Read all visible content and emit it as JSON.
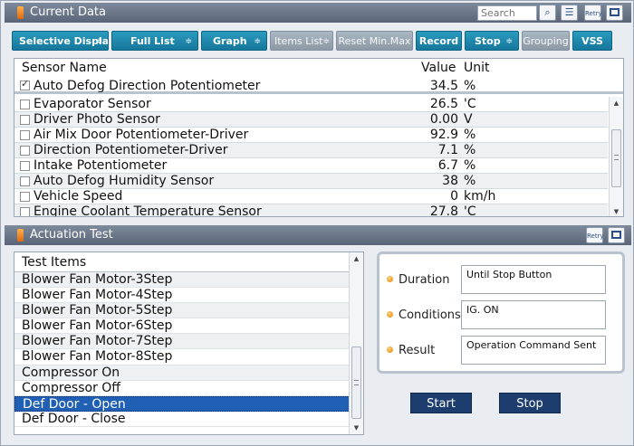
{
  "current_data": {
    "title": "Current Data",
    "search_placeholder": "Search",
    "retry_label": "Retry",
    "toolbar": {
      "selective_display": "Selective Display",
      "full_list": "Full List",
      "graph": "Graph",
      "items_list": "Items List",
      "reset_min_max": "Reset Min.Max",
      "record": "Record",
      "stop": "Stop",
      "grouping": "Grouping",
      "vss": "VSS",
      "dropdown_glyph": "≑"
    },
    "columns": {
      "name": "Sensor Name",
      "value": "Value",
      "unit": "Unit"
    },
    "pinned_row": {
      "name": "Auto Defog Direction Potentiometer",
      "value": "34.5",
      "unit": "%",
      "checked": true
    },
    "rows": [
      {
        "name": "Evaporator Sensor",
        "value": "26.5",
        "unit": "'C"
      },
      {
        "name": "Driver Photo Sensor",
        "value": "0.00",
        "unit": "V"
      },
      {
        "name": "Air Mix Door Potentiometer-Driver",
        "value": "92.9",
        "unit": "%"
      },
      {
        "name": "Direction Potentiometer-Driver",
        "value": "7.1",
        "unit": "%"
      },
      {
        "name": "Intake Potentiometer",
        "value": "6.7",
        "unit": "%"
      },
      {
        "name": "Auto Defog Humidity Sensor",
        "value": "38",
        "unit": "%"
      },
      {
        "name": "Vehicle Speed",
        "value": "0",
        "unit": "km/h"
      },
      {
        "name": "Engine Coolant Temperature Sensor",
        "value": "27.8",
        "unit": "'C"
      }
    ]
  },
  "actuation_test": {
    "title": "Actuation Test",
    "retry_label": "Retry",
    "list_header": "Test Items",
    "items": [
      "Blower Fan Motor-3Step",
      "Blower Fan Motor-4Step",
      "Blower Fan Motor-5Step",
      "Blower Fan Motor-6Step",
      "Blower Fan Motor-7Step",
      "Blower Fan Motor-8Step",
      "Compressor On",
      "Compressor Off",
      "Def Door - Open",
      "Def Door - Close"
    ],
    "selected_item": "Def Door - Open",
    "details": {
      "duration_label": "Duration",
      "duration_value": "Until Stop Button",
      "conditions_label": "Conditions",
      "conditions_value": "IG. ON",
      "result_label": "Result",
      "result_value": "Operation Command Sent"
    },
    "start_label": "Start",
    "stop_label": "Stop"
  },
  "colors": {
    "titlebar": "#5f6b7c",
    "toolbar_button": "#1f88ad",
    "toolbar_button_disabled": "#96a3af",
    "selection": "#1f5fb4",
    "action_button": "#1d3d6e"
  }
}
